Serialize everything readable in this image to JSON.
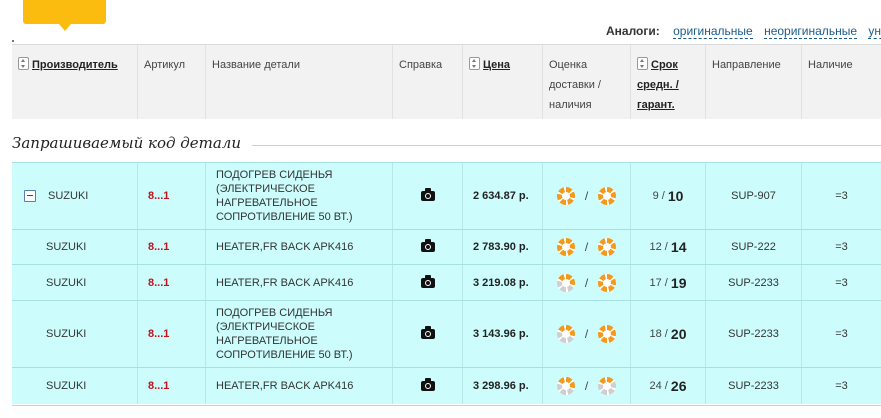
{
  "analogs": {
    "label": "Аналоги:",
    "links": [
      "оригинальные",
      "неоригинальные",
      "уни"
    ]
  },
  "headers": {
    "manufacturer": "Производитель",
    "article": "Артикул",
    "part_name": "Название детали",
    "info": "Справка",
    "price": "Цена",
    "rating_line1": "Оценка",
    "rating_line2": "доставки /",
    "rating_line3": "наличия",
    "term_line1": "Срок",
    "term_line2": "средн. /",
    "term_line3": "гарант.",
    "direction": "Направление",
    "availability": "Наличие"
  },
  "section_title": "Запрашиваемый код детали",
  "rows": [
    {
      "brand": "SUZUKI",
      "article": "8...1",
      "name": "ПОДОГРЕВ СИДЕНЬЯ (ЭЛЕКТРИЧЕСКОЕ НАГРЕВАТЕЛЬНОЕ СОПРОТИВЛЕНИЕ 50 ВТ.)",
      "price": "2 634.87 р.",
      "slash": "/",
      "term_avg": "9 /",
      "term_max": "10",
      "direction": "SUP-907",
      "availability": "=3",
      "rating_delivery": "full",
      "rating_stock": "full"
    },
    {
      "brand": "SUZUKI",
      "article": "8...1",
      "name": "HEATER,FR BACK APK416",
      "price": "2 783.90 р.",
      "slash": "/",
      "term_avg": "12 /",
      "term_max": "14",
      "direction": "SUP-222",
      "availability": "=3",
      "rating_delivery": "full",
      "rating_stock": "full"
    },
    {
      "brand": "SUZUKI",
      "article": "8...1",
      "name": "HEATER,FR BACK APK416",
      "price": "3 219.08 р.",
      "slash": "/",
      "term_avg": "17 /",
      "term_max": "19",
      "direction": "SUP-2233",
      "availability": "=3",
      "rating_delivery": "partial",
      "rating_stock": "full"
    },
    {
      "brand": "SUZUKI",
      "article": "8...1",
      "name": "ПОДОГРЕВ СИДЕНЬЯ (ЭЛЕКТРИЧЕСКОЕ НАГРЕВАТЕЛЬНОЕ СОПРОТИВЛЕНИЕ 50 ВТ.)",
      "price": "3 143.96 р.",
      "slash": "/",
      "term_avg": "18 /",
      "term_max": "20",
      "direction": "SUP-2233",
      "availability": "=3",
      "rating_delivery": "partial",
      "rating_stock": "full"
    },
    {
      "brand": "SUZUKI",
      "article": "8...1",
      "name": "HEATER,FR BACK APK416",
      "price": "3 298.96 р.",
      "slash": "/",
      "term_avg": "24 /",
      "term_max": "26",
      "direction": "SUP-2233",
      "availability": "=3",
      "rating_delivery": "partial",
      "rating_stock": "low"
    }
  ],
  "colors": {
    "row_bg": "#ccfdfc",
    "header_bg": "#f2f2f2",
    "accent_orange": "#fbbb0f",
    "article_red": "#c0141b",
    "link_blue": "#1c5c8c"
  }
}
